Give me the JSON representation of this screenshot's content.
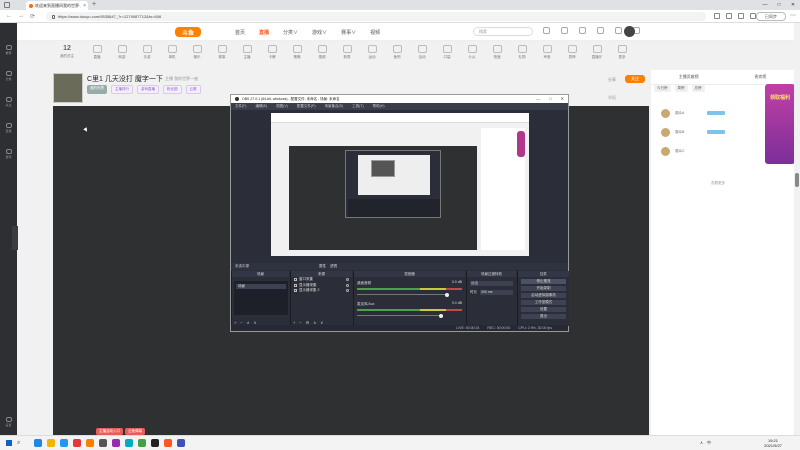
{
  "browser": {
    "tab_title": "欢迎来到直播间我的世界·上妤书、上云世界",
    "tab_close": "×",
    "new_tab": "+",
    "url": "https://www.douyu.com/9535847_?r=1279087712&fn=606",
    "sync_button": "已同步",
    "more": "⋯",
    "nav": [
      "←",
      "→",
      "⟳"
    ],
    "window_controls": [
      "—",
      "□",
      "✕"
    ]
  },
  "left_rail": {
    "items": [
      "推荐",
      "分类",
      "关注",
      "直播",
      "游戏"
    ],
    "bottom_item": "设置"
  },
  "site": {
    "logo": "斗鱼",
    "nav": [
      "首页",
      "直播",
      "分类∨",
      "游戏∨",
      "赛事∨",
      "视频"
    ],
    "active_index": 1,
    "search_placeholder": "搜索"
  },
  "categories": {
    "count_label": "12",
    "first_label": "我的关注",
    "items": [
      "直播",
      "网游",
      "手游",
      "单机",
      "娱乐",
      "赛事",
      "主播",
      "卡牌",
      "策略",
      "视频",
      "新秀",
      "运动",
      "鱼吧",
      "活动",
      "口袋",
      "仆从",
      "快速",
      "礼物",
      "声音",
      "男神",
      "直播厅",
      "更多"
    ]
  },
  "room": {
    "title": "C里1 几天没打 魔字一下",
    "meta": "主播  我的世界一座",
    "tags": [
      "我的世界",
      "主播排行",
      "游戏直播",
      "粉丝团",
      "云赛"
    ],
    "tabs": [
      "举报"
    ],
    "right_info": [
      "分享",
      "客户端"
    ],
    "follow_button": "关注",
    "report_link": "举报"
  },
  "player": {
    "gift_chips": [
      "主播活动入口",
      "云鱼弹幕"
    ]
  },
  "obs": {
    "title": "OBS 27.0.1 (64-bit, windows) - 配置文件: 未命名 - 场景: 未命名",
    "window_controls": [
      "—",
      "□",
      "✕"
    ],
    "menu": [
      "文件(F)",
      "编辑(E)",
      "视图(V)",
      "配置文件(P)",
      "场景集合(S)",
      "工具(T)",
      "帮助(H)"
    ],
    "scene_header_label": "未选中源",
    "scene_header_tabs": [
      "属性",
      "滤镜"
    ],
    "docks": {
      "scenes": {
        "title": "场景",
        "items": [
          "场景"
        ],
        "footer": [
          "+",
          "−",
          "∧",
          "∨"
        ]
      },
      "sources": {
        "title": "来源",
        "items": [
          "窗口采集",
          "显示器采集",
          "显示器采集 2"
        ],
        "footer": [
          "+",
          "−",
          "⚙",
          "∧",
          "∨"
        ]
      },
      "mixer": {
        "title": "混音器",
        "tracks": [
          {
            "name": "桌面音频",
            "db": "0.0 dB",
            "level": 0.88
          },
          {
            "name": "麦克风/Aux",
            "db": "0.0 dB",
            "level": 0.82
          }
        ]
      },
      "transitions": {
        "title": "场景过渡特效",
        "type_label": "淡出",
        "duration_label": "时长",
        "duration_value": "300 ms"
      },
      "controls": {
        "title": "控件",
        "buttons": [
          "停止推流",
          "开始录制",
          "启动虚拟摄像机",
          "工作室模式",
          "设置",
          "退出"
        ]
      }
    },
    "status": [
      "LIVE: 00:00:24",
      "REC: 00:00:00",
      "CPU: 2.9%, 30.00 fps"
    ]
  },
  "right_sidebar": {
    "tabs": [
      "主播贡献榜",
      "贵宾榜",
      "粉丝团"
    ],
    "sub_tabs": [
      "今日榜",
      "周榜",
      "总榜"
    ],
    "users": [
      "观众A",
      "观众B",
      "观众C"
    ],
    "more": "查看更多"
  },
  "promo": {
    "text": "领取福利"
  },
  "taskbar": {
    "search_icon": "⌕",
    "tray": [
      "∧",
      "中"
    ],
    "clock_time": "19:21",
    "clock_date": "2021/9/27"
  },
  "colors": {
    "accent": "#ff7f00",
    "obs_bg": "#2b2e38",
    "player_bg": "#2f3031"
  }
}
